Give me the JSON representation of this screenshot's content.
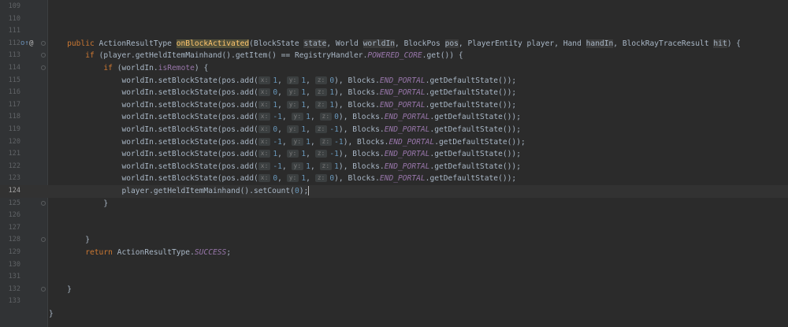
{
  "editor": {
    "line_numbers": [
      "109",
      "110",
      "111",
      "112",
      "113",
      "114",
      "115",
      "116",
      "117",
      "118",
      "119",
      "120",
      "121",
      "122",
      "123",
      "124",
      "125",
      "126",
      "127",
      "128",
      "129",
      "130",
      "131",
      "132",
      "133"
    ],
    "current_line": "124",
    "gutter_icons": {
      "override": "o↑",
      "annotation": "@"
    },
    "method_signature": {
      "kw_public": "public",
      "return_type": "ActionResultType",
      "name": "onBlockActivated",
      "p1_type": "(BlockState ",
      "p1_name": "state",
      "p2_type": ", World ",
      "p2_name": "worldIn",
      "p3_type": ", BlockPos ",
      "p3_name": "pos",
      "p4": ", PlayerEntity player, Hand ",
      "p5_name": "handIn",
      "p6_type": ", BlockRayTraceResult ",
      "p6_name": "hit",
      "end": ") {"
    },
    "if1": {
      "kw": "if",
      "a": "(player.getHeldItemMainhand().getItem() == RegistryHandler.",
      "const": "POWERED_CORE",
      "b": ".get()) {"
    },
    "if2": {
      "kw": "if",
      "a": "(worldIn.",
      "field": "isRemote",
      "b": ") {"
    },
    "set_calls": [
      {
        "x": "1",
        "y": "1",
        "z": "0"
      },
      {
        "x": "0",
        "y": "1",
        "z": "1"
      },
      {
        "x": "1",
        "y": "1",
        "z": "1"
      },
      {
        "x": "-1",
        "y": "1",
        "z": "0"
      },
      {
        "x": "0",
        "y": "1",
        "z": "-1"
      },
      {
        "x": "-1",
        "y": "1",
        "z": "-1"
      },
      {
        "x": "1",
        "y": "1",
        "z": "-1"
      },
      {
        "x": "-1",
        "y": "1",
        "z": "1"
      },
      {
        "x": "0",
        "y": "1",
        "z": "0"
      }
    ],
    "set_call_text": {
      "prefix": "worldIn.setBlockState(pos.add(",
      "hint_x": "x:",
      "hint_y": "y:",
      "hint_z": "z:",
      "comma": ",",
      "mid": "), Blocks.",
      "const": "END_PORTAL",
      "suffix": ".getDefaultState());"
    },
    "count_line": {
      "a": "player.getHeldItemMainhand().setCount(",
      "num": "0",
      "b": ");"
    },
    "close_brace": "}",
    "return_line": {
      "kw": "return",
      "a": "ActionResultType.",
      "const": "SUCCESS",
      "b": ";"
    }
  }
}
